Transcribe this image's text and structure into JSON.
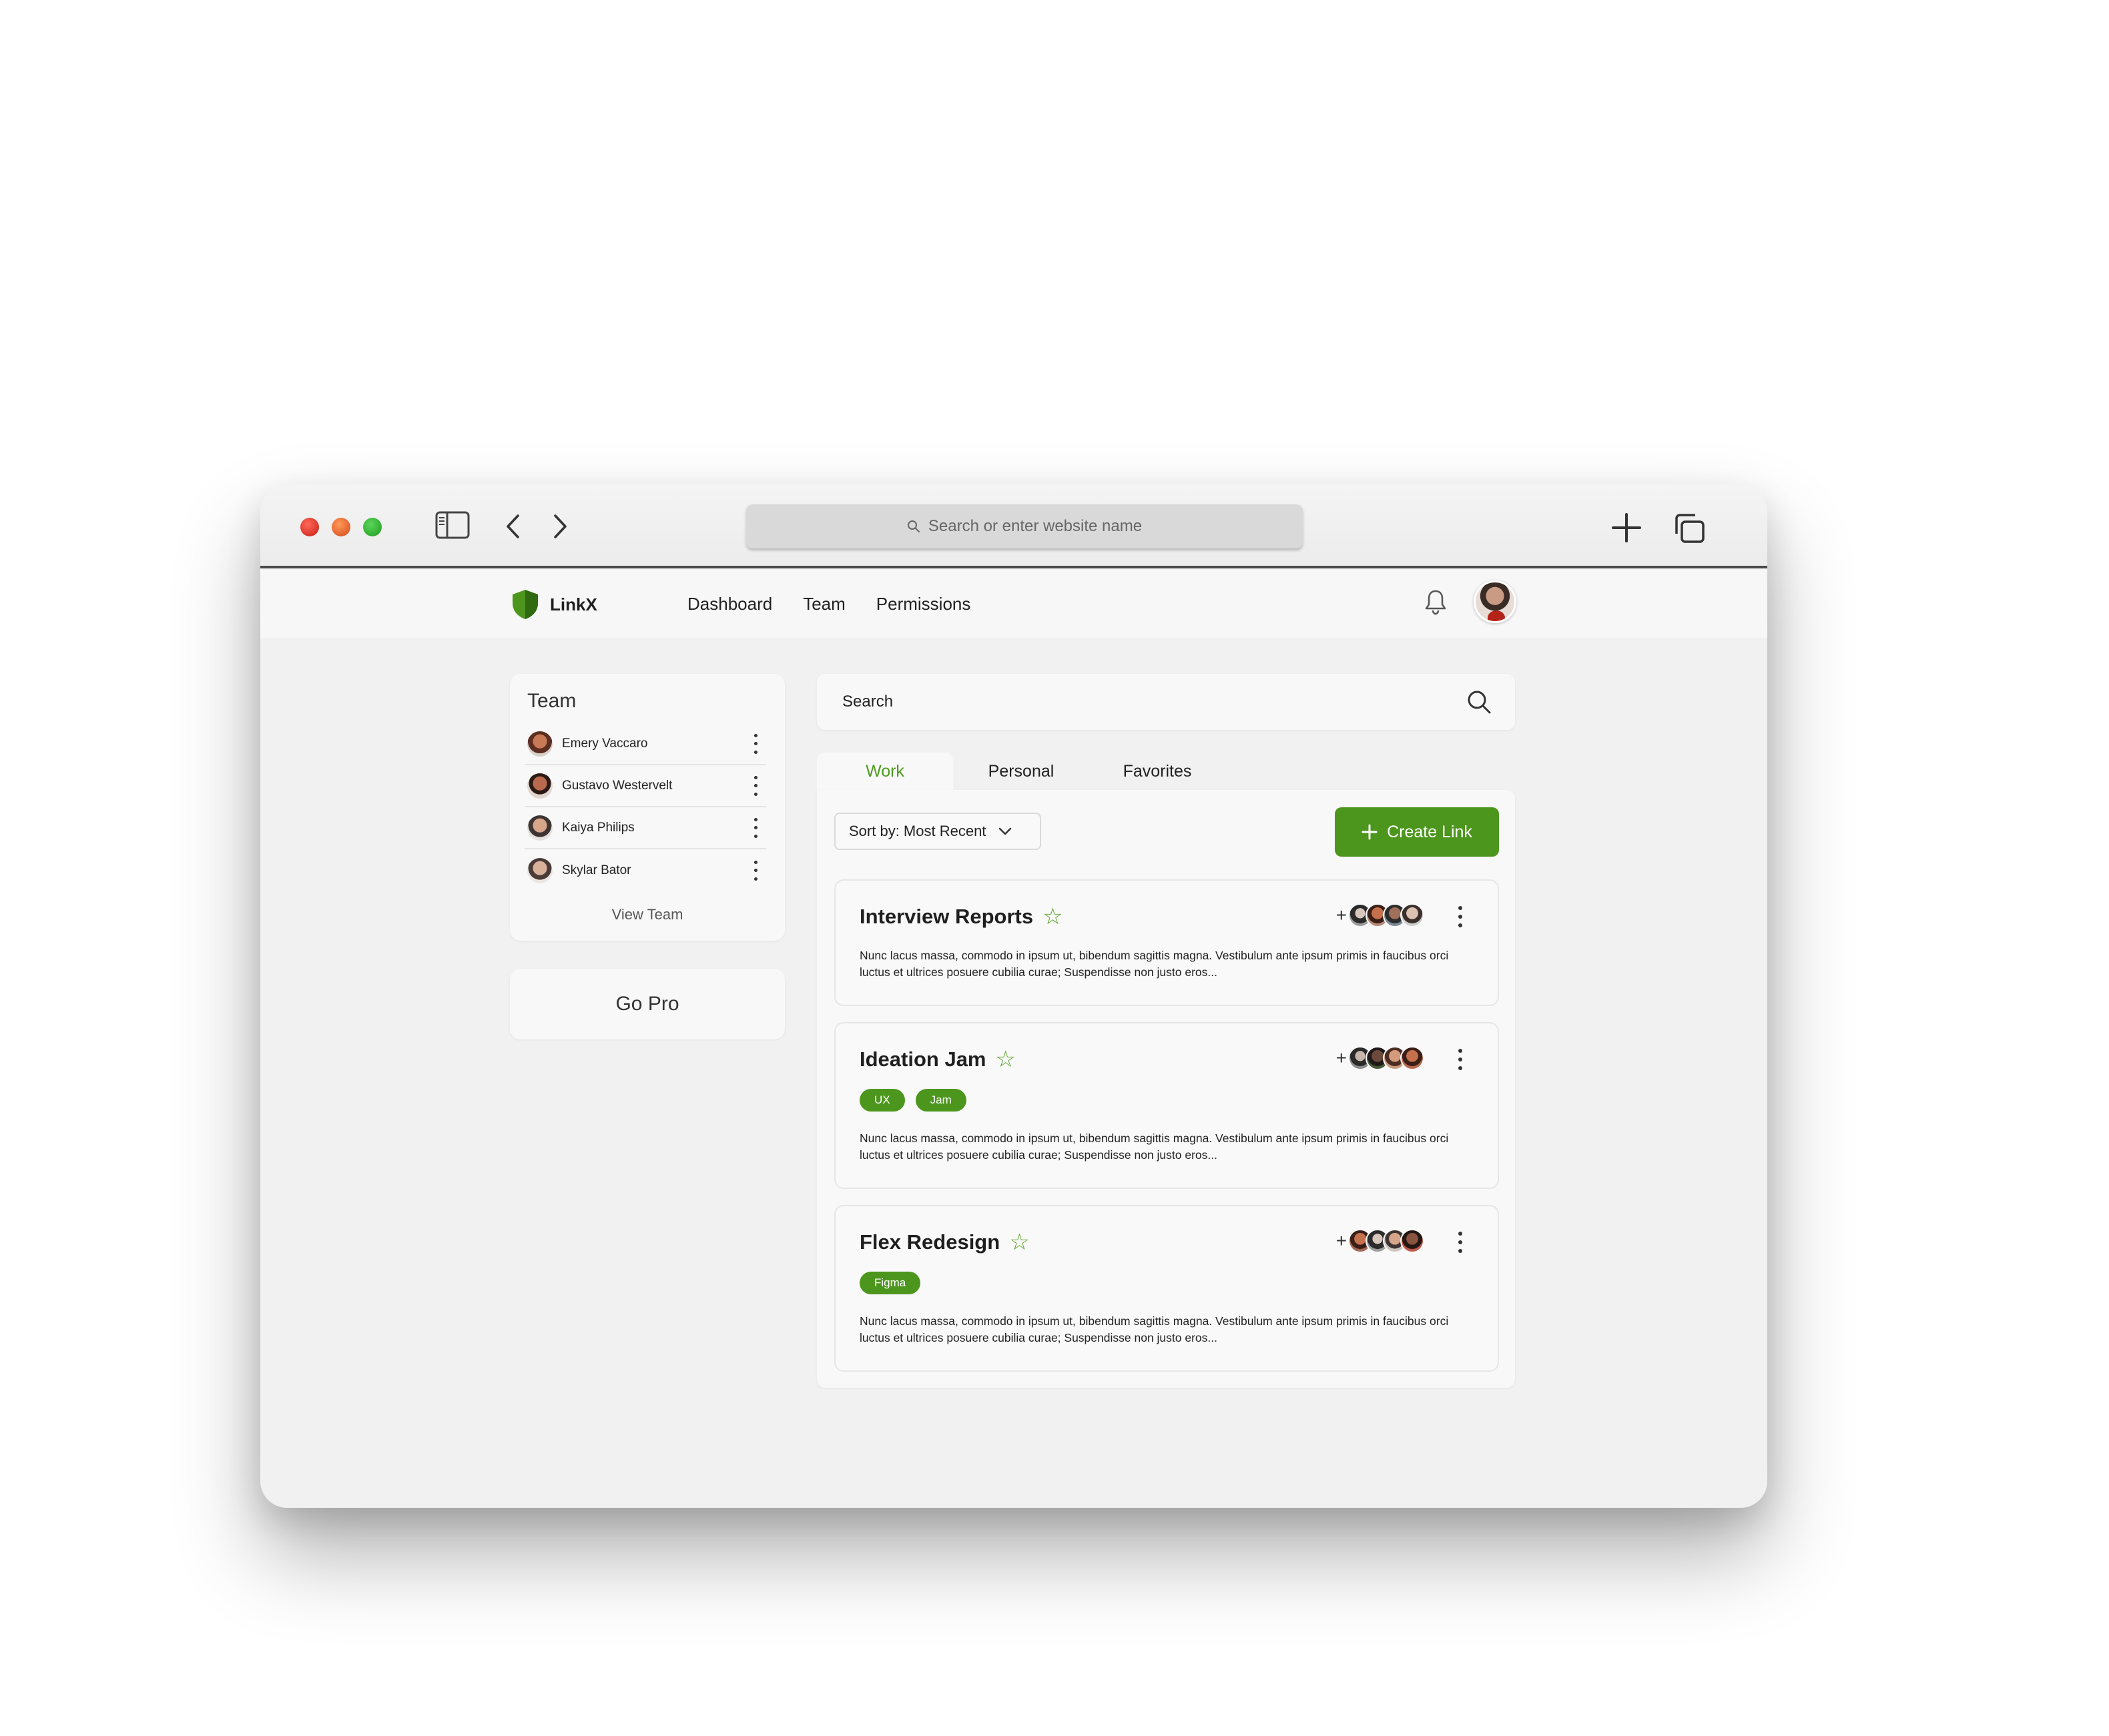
{
  "browser": {
    "address_placeholder": "Search or enter website name"
  },
  "app": {
    "logo_text": "LinkX",
    "nav": [
      "Dashboard",
      "Team",
      "Permissions"
    ]
  },
  "team_panel": {
    "title": "Team",
    "members": [
      {
        "name": "Emery Vaccaro"
      },
      {
        "name": "Gustavo Westervelt"
      },
      {
        "name": "Kaiya Philips"
      },
      {
        "name": "Skylar Bator"
      }
    ],
    "view_team_label": "View Team"
  },
  "go_pro_label": "Go Pro",
  "search": {
    "placeholder": "Search"
  },
  "tabs": [
    {
      "label": "Work",
      "active": true
    },
    {
      "label": "Personal",
      "active": false
    },
    {
      "label": "Favorites",
      "active": false
    }
  ],
  "sort_label": "Sort by: Most Recent",
  "create_link_label": "Create Link",
  "colors": {
    "accent": "#4d961e",
    "active_tab_text": "#4c9a1f"
  },
  "links": [
    {
      "title": "Interview Reports",
      "tags": [],
      "plus_label": "+",
      "description": "Nunc lacus massa, commodo in ipsum ut, bibendum sagittis magna. Vestibulum ante ipsum primis in faucibus orci luctus et ultrices posuere cubilia curae; Suspendisse non justo eros..."
    },
    {
      "title": "Ideation Jam",
      "tags": [
        "UX",
        "Jam"
      ],
      "plus_label": "+",
      "description": "Nunc lacus massa, commodo in ipsum ut, bibendum sagittis magna. Vestibulum ante ipsum primis in faucibus orci luctus et ultrices posuere cubilia curae; Suspendisse non justo eros..."
    },
    {
      "title": "Flex Redesign",
      "tags": [
        "Figma"
      ],
      "plus_label": "+",
      "description": "Nunc lacus massa, commodo in ipsum ut, bibendum sagittis magna. Vestibulum ante ipsum primis in faucibus orci luctus et ultrices posuere cubilia curae; Suspendisse non justo eros..."
    }
  ]
}
